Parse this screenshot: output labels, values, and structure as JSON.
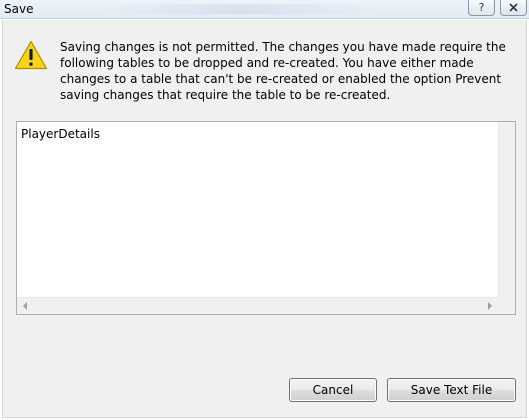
{
  "window": {
    "title": "Save",
    "help_label": "?"
  },
  "dialog": {
    "message": "Saving changes is not permitted. The changes you have made require the following tables to be dropped and re-created. You have either made changes to a table that can't be re-created or enabled the option Prevent saving changes that require the table to be re-created."
  },
  "list": {
    "items": [
      "PlayerDetails"
    ]
  },
  "buttons": {
    "cancel_label": "Cancel",
    "save_text_file_label": "Save Text File"
  },
  "colors": {
    "dialog_background": "#f0f0f0",
    "warning_yellow": "#f7d51c"
  },
  "icons": [
    "warning-icon",
    "help-icon",
    "close-icon"
  ]
}
